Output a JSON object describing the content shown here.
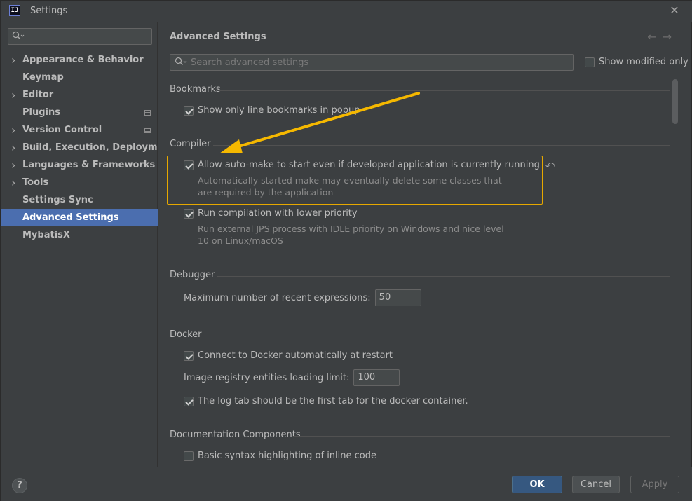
{
  "window": {
    "title": "Settings",
    "app_icon_text": "IJ"
  },
  "sidebar": {
    "search_placeholder": "",
    "items": [
      {
        "label": "Appearance & Behavior",
        "expandable": true,
        "project_level": false,
        "selected": false
      },
      {
        "label": "Keymap",
        "expandable": false,
        "project_level": false,
        "selected": false
      },
      {
        "label": "Editor",
        "expandable": true,
        "project_level": false,
        "selected": false
      },
      {
        "label": "Plugins",
        "expandable": false,
        "project_level": true,
        "selected": false
      },
      {
        "label": "Version Control",
        "expandable": true,
        "project_level": true,
        "selected": false
      },
      {
        "label": "Build, Execution, Deployment",
        "expandable": true,
        "project_level": false,
        "selected": false
      },
      {
        "label": "Languages & Frameworks",
        "expandable": true,
        "project_level": false,
        "selected": false
      },
      {
        "label": "Tools",
        "expandable": true,
        "project_level": false,
        "selected": false
      },
      {
        "label": "Settings Sync",
        "expandable": false,
        "project_level": false,
        "selected": false
      },
      {
        "label": "Advanced Settings",
        "expandable": false,
        "project_level": false,
        "selected": true
      },
      {
        "label": "MybatisX",
        "expandable": false,
        "project_level": false,
        "selected": false
      }
    ]
  },
  "main": {
    "title": "Advanced Settings",
    "search_placeholder": "Search advanced settings",
    "show_modified_only": {
      "label": "Show modified only",
      "checked": false
    },
    "sections": {
      "bookmarks": {
        "header": "Bookmarks",
        "line_bookmarks": {
          "label": "Show only line bookmarks in popup",
          "checked": true
        }
      },
      "compiler": {
        "header": "Compiler",
        "auto_make": {
          "label": "Allow auto-make to start even if developed application is currently running",
          "checked": true,
          "desc_line1": "Automatically started make may eventually delete some classes that",
          "desc_line2": "are required by the application"
        },
        "low_priority": {
          "label": "Run compilation with lower priority",
          "checked": true,
          "desc_line1": "Run external JPS process with IDLE priority on Windows and nice level",
          "desc_line2": "10 on Linux/macOS"
        }
      },
      "debugger": {
        "header": "Debugger",
        "recent_expressions": {
          "label": "Maximum number of recent expressions:",
          "value": "50"
        }
      },
      "docker": {
        "header": "Docker",
        "auto_connect": {
          "label": "Connect to Docker automatically at restart",
          "checked": true
        },
        "registry_limit": {
          "label": "Image registry entities loading limit:",
          "value": "100"
        },
        "log_tab_first": {
          "label": "The log tab should be the first tab for the docker container.",
          "checked": true
        }
      },
      "documentation": {
        "header": "Documentation Components",
        "syntax_highlighting": {
          "label": "Basic syntax highlighting of inline code",
          "checked": false
        }
      }
    }
  },
  "footer": {
    "help_label": "?",
    "ok_label": "OK",
    "cancel_label": "Cancel",
    "apply_label": "Apply"
  },
  "colors": {
    "background": "#3c3f41",
    "selection": "#4b6eaf",
    "highlight_border": "#e6a800",
    "annotation_arrow": "#f5b800",
    "ok_button": "#365880"
  }
}
